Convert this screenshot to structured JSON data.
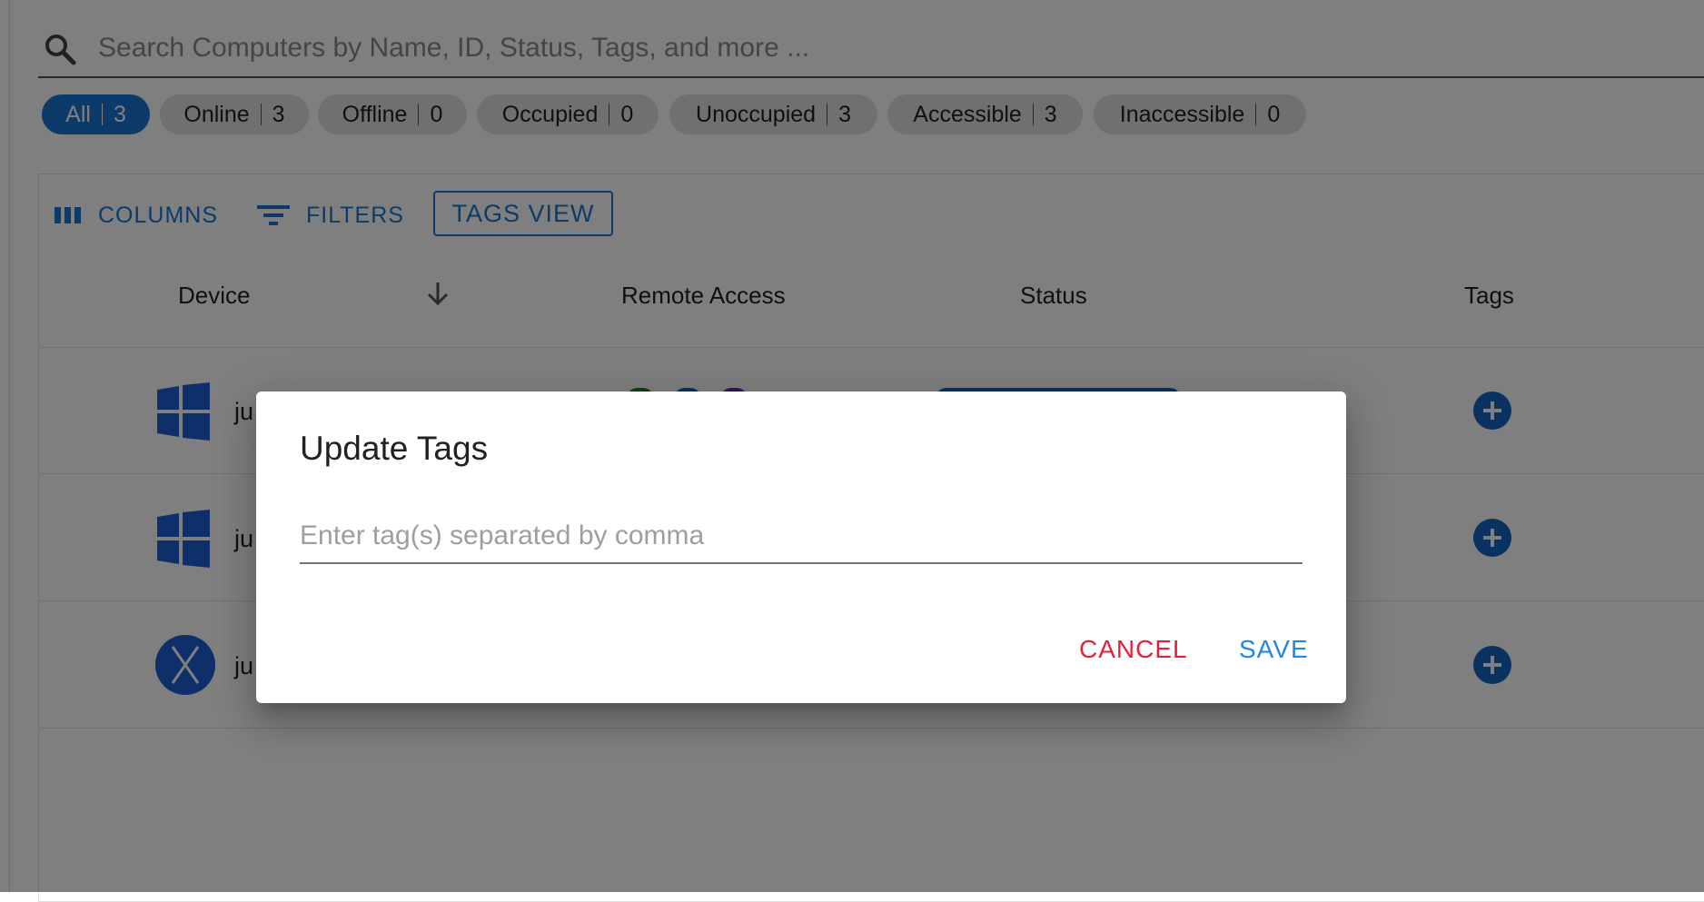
{
  "search": {
    "placeholder": "Search Computers by Name, ID, Status, Tags, and more ...",
    "value": ""
  },
  "filters": [
    {
      "label": "All",
      "count": "3",
      "active": true
    },
    {
      "label": "Online",
      "count": "3"
    },
    {
      "label": "Offline",
      "count": "0"
    },
    {
      "label": "Occupied",
      "count": "0"
    },
    {
      "label": "Unoccupied",
      "count": "3"
    },
    {
      "label": "Accessible",
      "count": "3"
    },
    {
      "label": "Inaccessible",
      "count": "0"
    }
  ],
  "toolbar": {
    "columns_label": "COLUMNS",
    "filters_label": "FILTERS",
    "tags_view_label": "TAGS VIEW"
  },
  "table": {
    "headers": {
      "device": "Device",
      "remote_access": "Remote Access",
      "status": "Status",
      "tags": "Tags"
    },
    "rows": [
      {
        "os_icon": "windows-icon",
        "device_prefix": "ju"
      },
      {
        "os_icon": "windows-icon",
        "device_prefix": "ju"
      },
      {
        "os_icon": "macos-x-icon",
        "device_prefix": "ju"
      }
    ]
  },
  "dialog": {
    "title": "Update Tags",
    "input_placeholder": "Enter tag(s) separated by comma",
    "input_value": "",
    "cancel_label": "CANCEL",
    "save_label": "SAVE"
  },
  "colors": {
    "accent": "#1976d2",
    "cancel": "#e91e3a",
    "save": "#1e88e5",
    "windows": "#1e5ed6"
  }
}
